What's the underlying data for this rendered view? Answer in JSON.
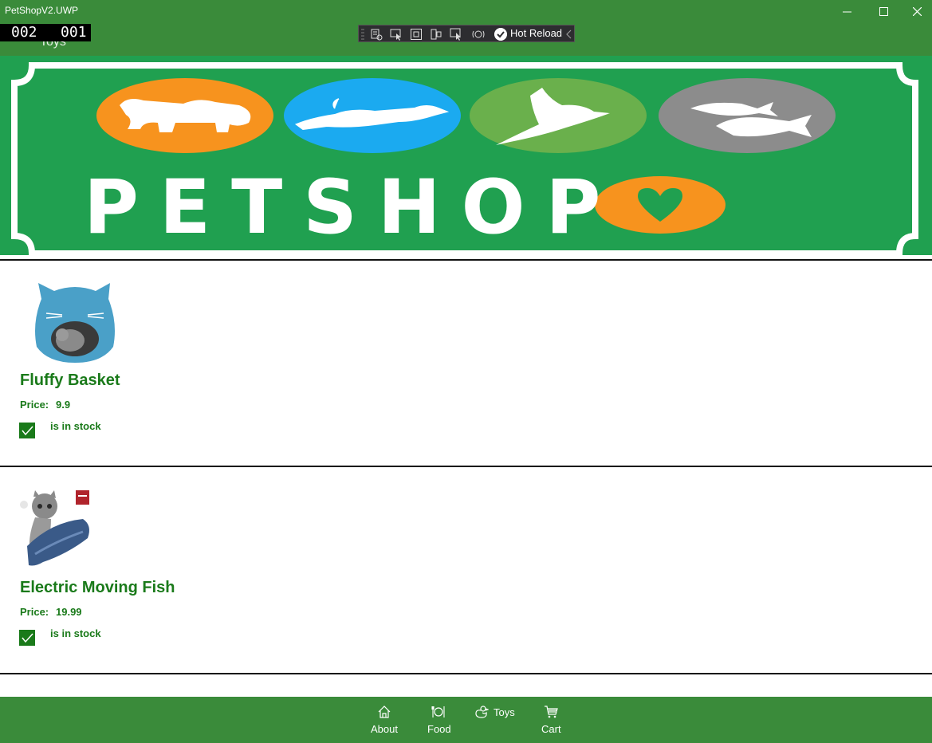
{
  "window": {
    "title": "PetShopV2.UWP",
    "page_label": "Toys",
    "frame_counter": [
      "002",
      "001"
    ]
  },
  "debug_toolbar": {
    "hot_reload_label": "Hot Reload"
  },
  "banner": {
    "logo_text": "PETSHOP",
    "colors": {
      "background": "#20a050",
      "orange": "#f7931e",
      "blue": "#1baaf0",
      "green": "#6ab04c",
      "gray": "#8c8c8c"
    }
  },
  "products": [
    {
      "name": "Fluffy Basket",
      "price_label": "Price:",
      "price": "9.9",
      "stock_label": "is in stock",
      "in_stock": true
    },
    {
      "name": "Electric Moving Fish",
      "price_label": "Price:",
      "price": "19.99",
      "stock_label": "is in stock",
      "in_stock": true
    }
  ],
  "nav": {
    "items": [
      {
        "label": "About",
        "icon": "home-icon"
      },
      {
        "label": "Food",
        "icon": "food-icon"
      },
      {
        "label": "Toys",
        "icon": "toy-duck-icon"
      },
      {
        "label": "Cart",
        "icon": "cart-icon"
      }
    ]
  },
  "theme": {
    "primary": "#3a8b3a",
    "text_green": "#1a7a1a"
  }
}
